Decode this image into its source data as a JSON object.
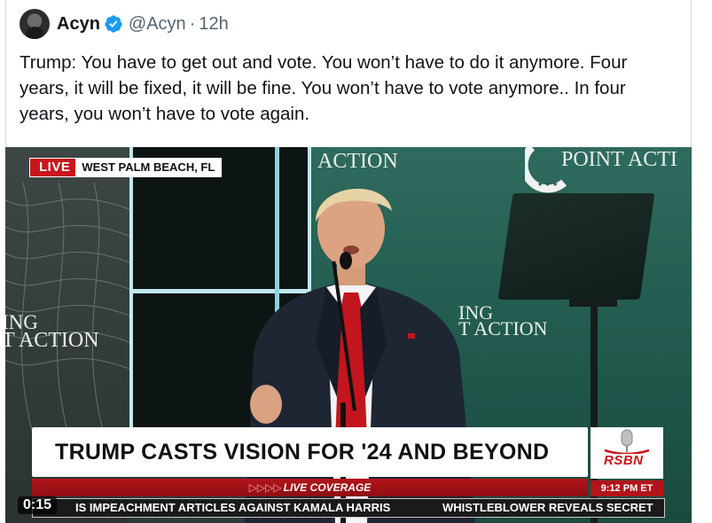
{
  "author": {
    "name": "Acyn",
    "handle": "@Acyn",
    "separator": "·",
    "time": "12h",
    "verified_color": "#1d9bf0"
  },
  "tweet": {
    "text": "Trump: You have to get out and vote. You won’t have to do it anymore. Four years, it will be fixed, it will be fine. You won’t have to vote anymore.. In four years, you won’t have to vote again."
  },
  "video": {
    "duration": "0:15",
    "live_label": "LIVE",
    "location": "WEST PALM BEACH, FL",
    "stage": {
      "action_top": "ACTION",
      "point_top": "POINT ACTI",
      "ing_left": "ING",
      "action_left": "T ACTION",
      "ing_center": "ING",
      "action_center": "T ACTION"
    },
    "headline": "TRUMP CASTS VISION FOR '24 AND BEYOND",
    "live_coverage": "LIVE COVERAGE",
    "live_coverage_arrows": "▷▷▷▷",
    "network": "RSBN",
    "clock": "9:12 PM ET",
    "ticker": [
      "IS IMPEACHMENT ARTICLES AGAINST KAMALA HARRIS",
      "WHISTLEBLOWER REVEALS SECRET"
    ]
  }
}
